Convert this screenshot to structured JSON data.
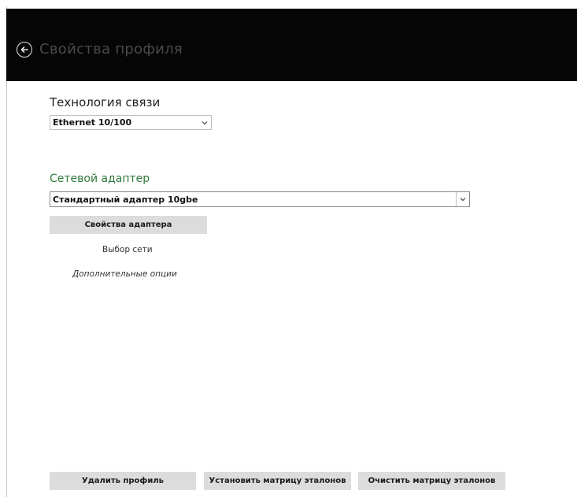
{
  "header": {
    "title": "Свойства профиля"
  },
  "communication": {
    "label": "Технология связи",
    "selected": "Ethernet 10/100"
  },
  "adapter": {
    "label": "Сетевой адаптер",
    "selected": "Стандартный адаптер 10gbe",
    "properties_button": "Свойства адаптера"
  },
  "links": {
    "network_select": "Выбор сети",
    "additional_options": "Дополнительные опции"
  },
  "footer": {
    "delete_profile": "Удалить профиль",
    "set_matrix": "Установить матрицу эталонов",
    "clear_matrix": "Очистить матрицу эталонов"
  },
  "colors": {
    "header_bg": "#050505",
    "accent_green": "#2f7a3a",
    "button_bg": "#dcdcdc"
  },
  "icons": {
    "back": "back-arrow-circle-icon",
    "dropdown": "chevron-down-icon"
  }
}
